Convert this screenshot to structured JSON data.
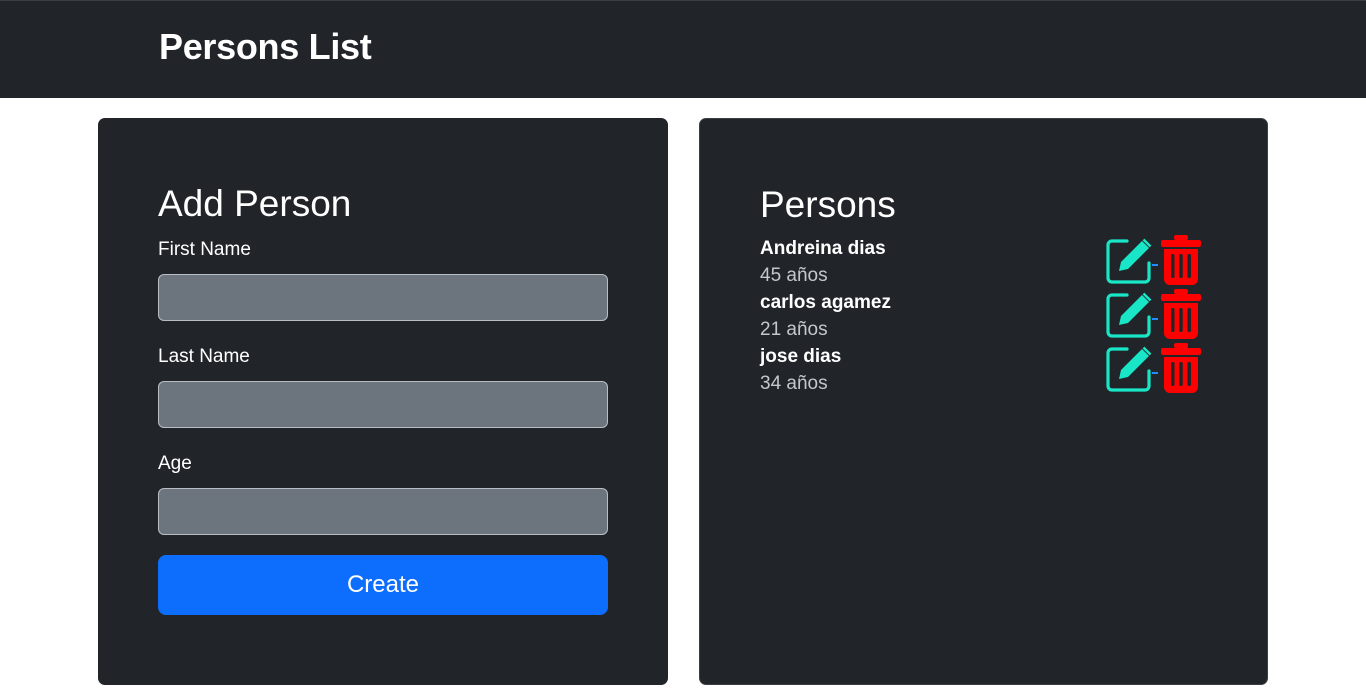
{
  "header": {
    "title": "Persons List"
  },
  "add_form": {
    "title": "Add Person",
    "fields": [
      {
        "label": "First Name",
        "value": "",
        "placeholder": ""
      },
      {
        "label": "Last Name",
        "value": "",
        "placeholder": ""
      },
      {
        "label": "Age",
        "value": "",
        "placeholder": ""
      }
    ],
    "submit_label": "Create"
  },
  "persons_panel": {
    "title": "Persons",
    "persons": [
      {
        "name": "Andreina dias",
        "age": "45 años"
      },
      {
        "name": "carlos agamez",
        "age": "21 años"
      },
      {
        "name": "jose dias",
        "age": "34 años"
      }
    ],
    "actions": {
      "edit_icon": "pencil-square-icon",
      "delete_icon": "trash-icon"
    }
  },
  "colors": {
    "nav_bg": "#212529",
    "card_bg": "#212529",
    "input_bg": "#6c757d",
    "primary": "#0d6efd",
    "edit_icon": "#19e6c7",
    "delete_icon": "#ff0000"
  }
}
